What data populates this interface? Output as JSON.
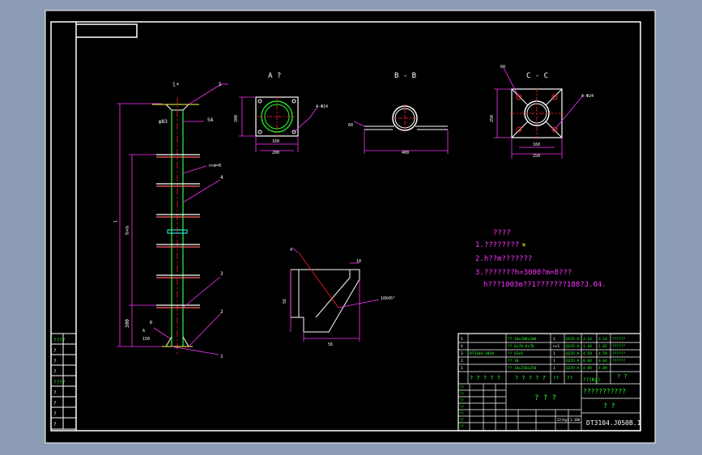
{
  "colors": {
    "background": "#8a9bb3",
    "sheet": "#000000",
    "frame": "#ffffff",
    "dimension": "#ff33ff",
    "red": "#ff2020",
    "green": "#2aff2a",
    "yellow": "#ffff33",
    "cyan": "#33ffff",
    "text": "#ffffff"
  },
  "views": {
    "section_a": "A  ?",
    "section_b": "B - B",
    "section_c": "C - C"
  },
  "notes": {
    "heading": "????",
    "line1": "1.????????",
    "line2": "2.h??m???????",
    "line3": "3.???????h=3000?m=8???",
    "line4": "h???1003m??1???????188?J.04."
  },
  "title_block": {
    "project": "???????????",
    "part_name": "? ? ?",
    "unit": "? ?",
    "drawing_no": "DT3104.J050B.1",
    "scale_label": "??(Kg)",
    "scale_value": "? ?",
    "footer_left": "? ? ? ? ?",
    "footer_mid": "? ? ? ? ?"
  },
  "left_strip": [
    "????",
    "?",
    "?",
    "?",
    "????",
    "?",
    "?",
    "?",
    "?"
  ],
  "bom": [
    {
      "no": "5",
      "code": "",
      "name": "?? 10x200x200",
      "qty": "1",
      "mat": "Q235-A",
      "w1": "3.14",
      "w2": "3.14",
      "note": "??????"
    },
    {
      "no": "4",
      "code": "",
      "name": "?? 6x70-6x70",
      "qty": "n+1",
      "mat": "Q235-A",
      "w1": "1.10",
      "w2": "1.82",
      "note": "??????"
    },
    {
      "no": "3",
      "code": "DT3104-J050",
      "name": "?? 63x5",
      "qty": "1",
      "mat": "Q235-A",
      "w1": "4.59",
      "w2": "4.59",
      "note": "??????"
    },
    {
      "no": "2",
      "code": "",
      "name": "?? 30",
      "qty": "1",
      "mat": "Q235-A",
      "w1": "0.64",
      "w2": "0.64",
      "note": "??????"
    },
    {
      "no": "1",
      "code": "",
      "name": "?? 10x250x250",
      "qty": "1",
      "mat": "Q235-A",
      "w1": "4.89",
      "w2": "4.89",
      "note": ""
    }
  ]
}
